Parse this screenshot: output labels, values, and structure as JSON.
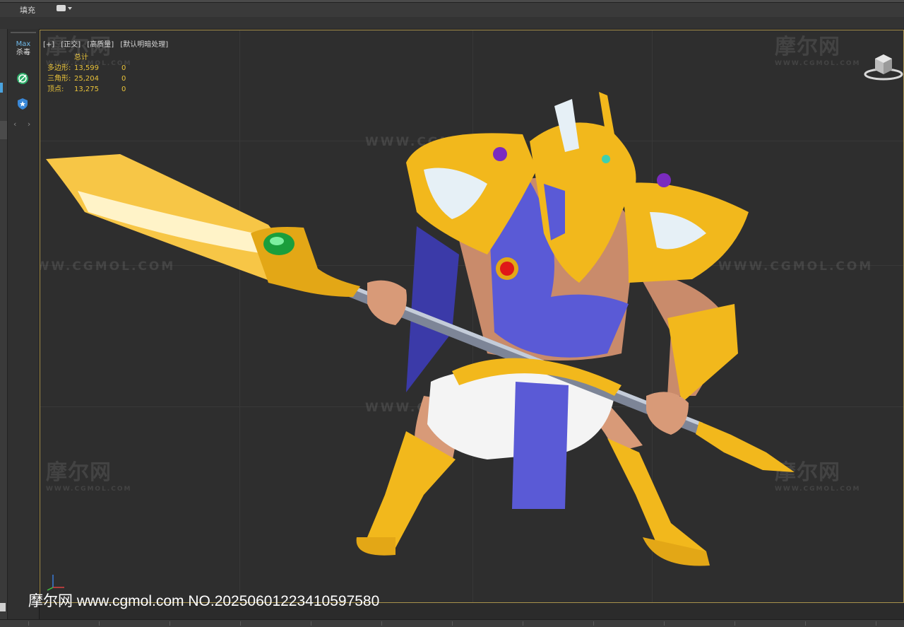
{
  "toolbar": {
    "fill_label": "填充"
  },
  "sidebar": {
    "badge_top": "Max",
    "badge_bottom": "杀毒"
  },
  "viewport": {
    "labels": [
      "[+]",
      "[正交]",
      "[高质量]",
      "[默认明暗处理]"
    ],
    "stats": {
      "header": "总计",
      "rows": [
        {
          "label": "多边形:",
          "total": "13,599",
          "selected": "0"
        },
        {
          "label": "三角形:",
          "total": "25,204",
          "selected": "0"
        },
        {
          "label": "顶点:",
          "total": "13,275",
          "selected": "0"
        }
      ]
    }
  },
  "watermark": {
    "logo_text": "摩尔网",
    "logo_sub": "WWW.CGMOL.COM",
    "url_text": "WWW.CGMOL.COM"
  },
  "footer": {
    "credit": "摩尔网 www.cgmol.com NO.20250601223410597580"
  },
  "colors": {
    "viewport_border": "#a8914b",
    "stats_text": "#e8c23a",
    "gold": "#f2b81c",
    "cloth_blue": "#5a5ad6"
  }
}
